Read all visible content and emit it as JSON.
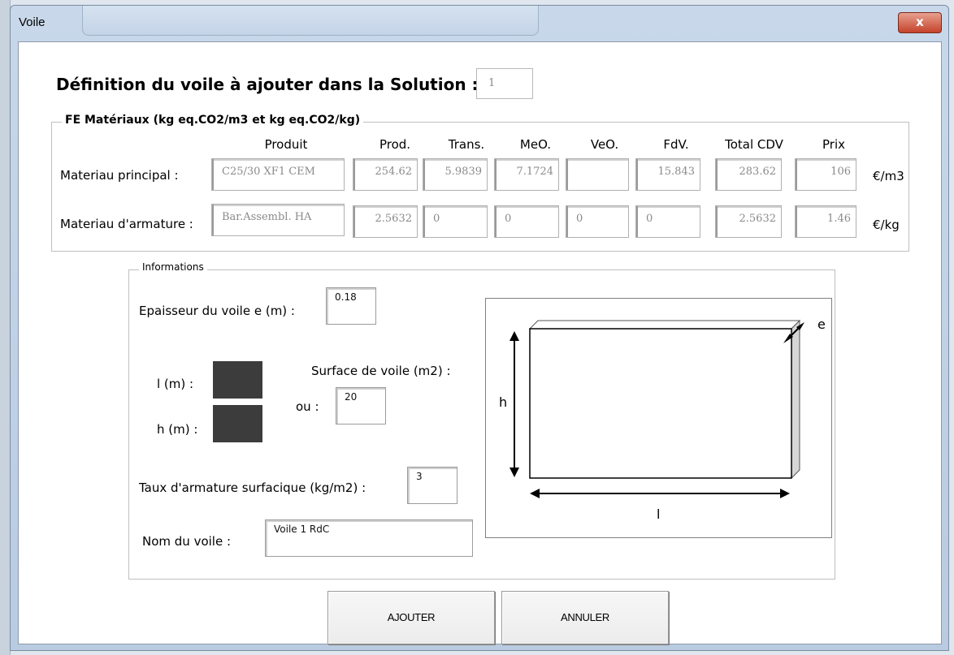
{
  "window": {
    "title": "Voile",
    "close_label": "x"
  },
  "header": {
    "heading": "Définition du voile à ajouter dans la Solution :",
    "solution_number": "1"
  },
  "materials": {
    "legend": "FE Matériaux (kg eq.CO2/m3 et kg eq.CO2/kg)",
    "columns": [
      "Produit",
      "Prod.",
      "Trans.",
      "MeO.",
      "VeO.",
      "FdV.",
      "Total CDV",
      "Prix"
    ],
    "rows": [
      {
        "label": "Materiau principal :",
        "produit": "C25/30 XF1 CEM",
        "prod": "254.62",
        "trans": "5.9839",
        "meo": "7.1724",
        "veo": "",
        "fdv": "15.843",
        "total": "283.62",
        "prix": "106",
        "unit": "€/m3"
      },
      {
        "label": "Materiau d'armature :",
        "produit": "Bar.Assembl. HA",
        "prod": "2.5632",
        "trans": "0",
        "meo": "0",
        "veo": "0",
        "fdv": "0",
        "total": "2.5632",
        "prix": "1.46",
        "unit": "€/kg"
      }
    ]
  },
  "informations": {
    "legend": "Informations",
    "epaisseur_label": "Epaisseur du voile e (m) :",
    "epaisseur_value": "0.18",
    "l_label": "l (m) :",
    "h_label": "h (m) :",
    "ou_label": "ou :",
    "surface_label": "Surface de voile (m2) :",
    "surface_value": "20",
    "taux_label": "Taux d'armature surfacique (kg/m2) :",
    "taux_value": "3",
    "nom_label": "Nom du voile :",
    "nom_value": "Voile 1 RdC"
  },
  "diagram": {
    "e_label": "e",
    "h_label": "h",
    "l_label": "l"
  },
  "buttons": {
    "ajouter": "AJOUTER",
    "annuler": "ANNULER"
  }
}
